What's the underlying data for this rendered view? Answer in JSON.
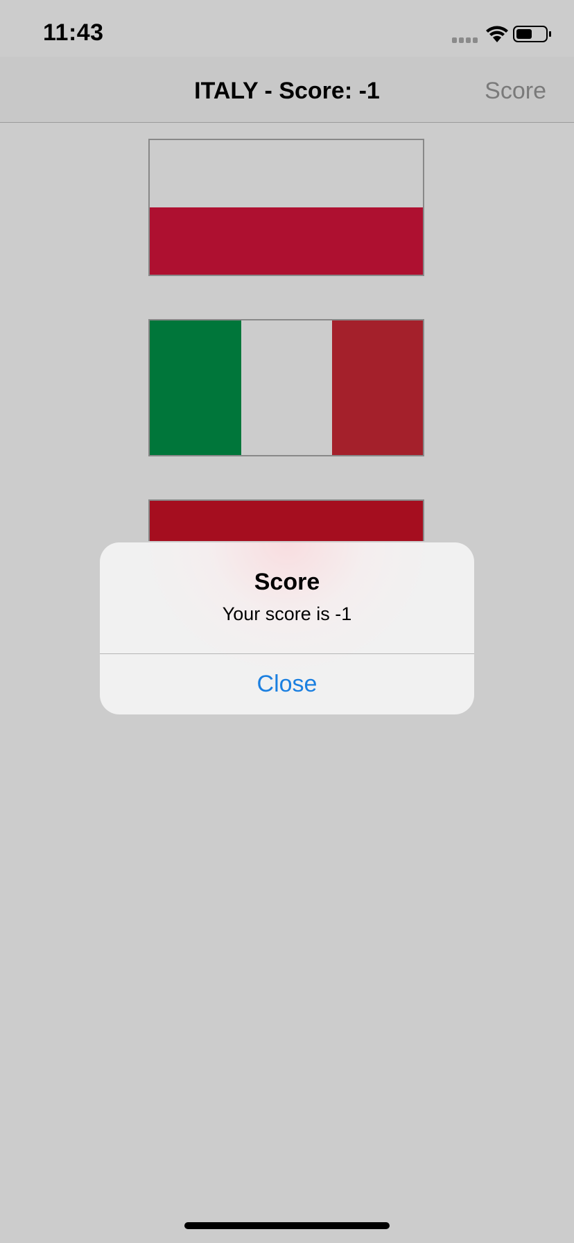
{
  "status_bar": {
    "time": "11:43"
  },
  "nav": {
    "title": "ITALY - Score: -1",
    "score_button": "Score"
  },
  "flags": [
    {
      "name": "poland-flag",
      "colors": [
        "#cccccc",
        "#ae1030"
      ]
    },
    {
      "name": "italy-flag",
      "colors": [
        "#00763a",
        "#cccccc",
        "#a4202b"
      ]
    },
    {
      "name": "red-flag-partial",
      "colors": [
        "#a50e1f"
      ]
    }
  ],
  "alert": {
    "title": "Score",
    "message": "Your score is -1",
    "close_label": "Close"
  },
  "colors": {
    "background": "#cccccc",
    "accent": "#1a7fe0"
  }
}
